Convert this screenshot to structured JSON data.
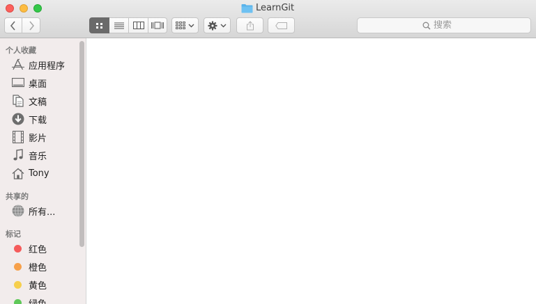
{
  "window": {
    "title": "LearnGit"
  },
  "toolbar": {
    "search_placeholder": "搜索"
  },
  "sidebar": {
    "favorites_heading": "个人收藏",
    "favorites": [
      {
        "label": "应用程序",
        "icon": "applications-icon"
      },
      {
        "label": "桌面",
        "icon": "desktop-icon"
      },
      {
        "label": "文稿",
        "icon": "documents-icon"
      },
      {
        "label": "下载",
        "icon": "downloads-icon"
      },
      {
        "label": "影片",
        "icon": "movies-icon"
      },
      {
        "label": "音乐",
        "icon": "music-icon"
      },
      {
        "label": "Tony",
        "icon": "home-icon"
      }
    ],
    "shared_heading": "共享的",
    "shared": [
      {
        "label": "所有...",
        "icon": "network-icon"
      }
    ],
    "tags_heading": "标记",
    "tags": [
      {
        "label": "红色",
        "color": "#f55b5b"
      },
      {
        "label": "橙色",
        "color": "#f7a04a"
      },
      {
        "label": "黄色",
        "color": "#f6cf4d"
      },
      {
        "label": "绿色",
        "color": "#5fc859"
      }
    ]
  },
  "colors": {
    "close": "#fc605c",
    "minimize": "#fdbc40",
    "zoom": "#34c84a",
    "sidebar_bg": "#f2ecec",
    "selected_view": "#6a6a6a",
    "folder": "#5ab3ea"
  }
}
